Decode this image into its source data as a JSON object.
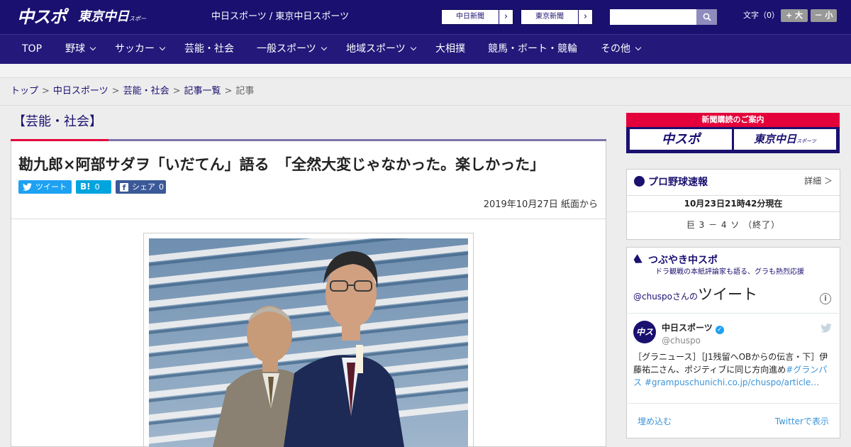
{
  "header": {
    "logo_chuspo": "中スポ",
    "logo_tokyo": "東京中日",
    "logo_tokyo_small": "スポーツ",
    "site_name": "中日スポーツ / 東京中日スポーツ",
    "links": [
      {
        "label": "中日新聞"
      },
      {
        "label": "東京新聞"
      }
    ],
    "search_placeholder": "",
    "font_size_label": "文字（0）",
    "font_bigger": "+ 大",
    "font_smaller": "－ 小"
  },
  "nav": {
    "items": [
      {
        "label": "TOP",
        "has_menu": false
      },
      {
        "label": "野球",
        "has_menu": true
      },
      {
        "label": "サッカー",
        "has_menu": true
      },
      {
        "label": "芸能・社会",
        "has_menu": false
      },
      {
        "label": "一般スポーツ",
        "has_menu": true
      },
      {
        "label": "地域スポーツ",
        "has_menu": true
      },
      {
        "label": "大相撲",
        "has_menu": false
      },
      {
        "label": "競馬・ボート・競輪",
        "has_menu": false
      },
      {
        "label": "その他",
        "has_menu": true
      }
    ]
  },
  "breadcrumb": [
    "トップ",
    "中日スポーツ",
    "芸能・社会",
    "記事一覧",
    "記事"
  ],
  "article": {
    "category": "【芸能・社会】",
    "headline": "勘九郎×阿部サダヲ「いだてん」語る　「全然大変じゃなかった。楽しかった」",
    "share": {
      "tweet": "ツイート",
      "hatena_icon": "B!",
      "hatena_count": "0",
      "facebook_label": "シェア",
      "facebook_count": "0"
    },
    "date": "2019年10月27日 紙面から"
  },
  "sidebar": {
    "subscribe_title": "新聞購読のご案内",
    "subscribe_left": "中スポ",
    "subscribe_right": "東京中日",
    "subscribe_right_small": "スポーツ",
    "baseball": {
      "title": "プロ野球速報",
      "more": "詳細 ＞",
      "time": "10月23日21時42分現在",
      "score": "巨 3 － 4 ソ （終了）"
    },
    "tweets": {
      "title": "つぶやき中スポ",
      "subtitle": "ドラ観戦の本紙評論家も語る、グラも熱烈応援",
      "header_handle": "@chuspo",
      "header_suffix": "さんの",
      "header_big": "ツイート",
      "info": "i",
      "avatar": "中スポ",
      "name": "中日スポーツ",
      "verified": "✓",
      "handle": "@chuspo",
      "text_plain": "［グラニュース］［J1残留へOBからの伝言・下］伊藤祐二さん、ポジティブに同じ方向進め",
      "text_link": "#グランパス #grampuschunichi.co.jp/chuspo/article…",
      "embed": "埋め込む",
      "view_on": "Twitterで表示"
    }
  },
  "colors": {
    "brand_navy": "#1a1070",
    "accent_red": "#e4003a",
    "twitter": "#1da1f2",
    "hatena": "#00a4de",
    "facebook": "#3b5998"
  }
}
